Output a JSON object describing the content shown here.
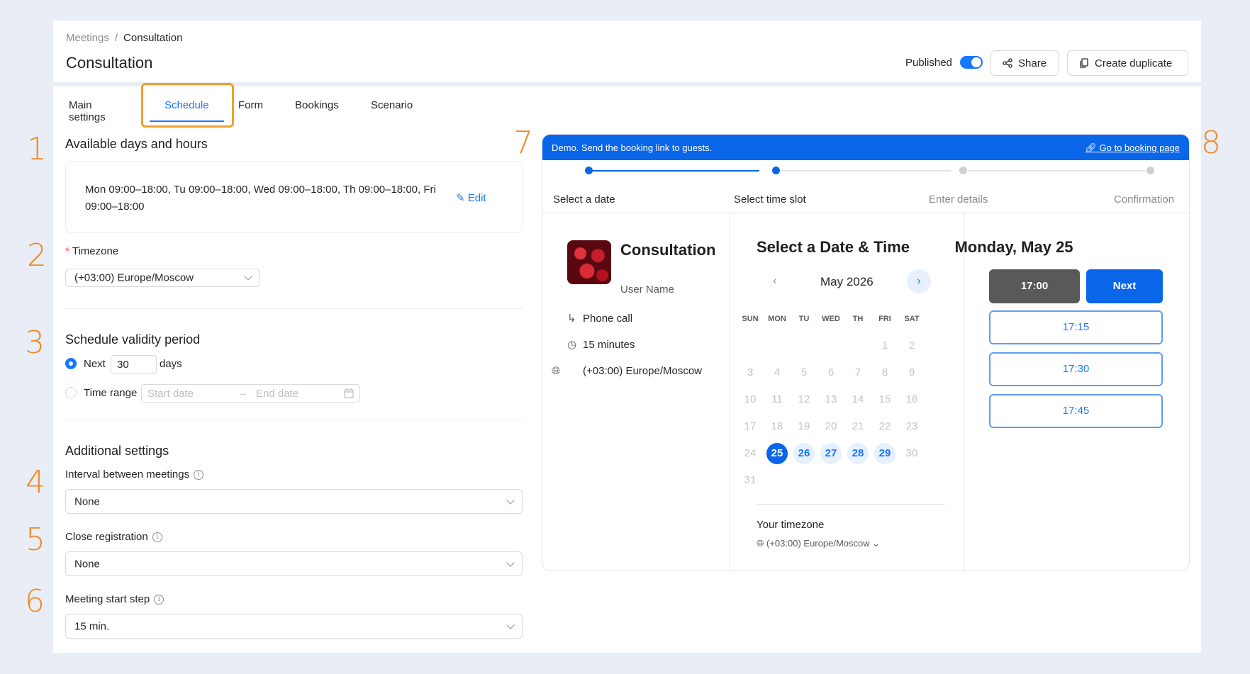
{
  "header": {
    "breadcrumb": [
      "Meetings",
      "Consultation"
    ],
    "breadcrumb_sep": "/",
    "title": "Consultation",
    "published_label": "Published",
    "share_label": "Share",
    "duplicate_label": "Create duplicate"
  },
  "tabs": [
    {
      "label": "Main settings",
      "active": false
    },
    {
      "label": "Schedule",
      "active": true
    },
    {
      "label": "Form",
      "active": false
    },
    {
      "label": "Bookings",
      "active": false
    },
    {
      "label": "Scenario",
      "active": false
    }
  ],
  "annotations": [
    "1",
    "2",
    "3",
    "4",
    "5",
    "6",
    "7",
    "8"
  ],
  "schedule": {
    "available_title": "Available days and hours",
    "hours_text": "Mon 09:00–18:00, Tu 09:00–18:00, Wed 09:00–18:00, Th 09:00–18:00, Fri 09:00–18:00",
    "edit_label": "Edit",
    "timezone_label": "Timezone",
    "timezone_value": "(+03:00) Europe/Moscow",
    "validity_title": "Schedule validity period",
    "next_label": "Next",
    "next_value": "30",
    "days_label": "days",
    "time_range_label": "Time range",
    "start_placeholder": "Start date",
    "end_placeholder": "End date",
    "additional_title": "Additional settings",
    "interval_label": "Interval between meetings",
    "interval_value": "None",
    "close_label": "Close registration",
    "close_value": "None",
    "step_label": "Meeting start step",
    "step_value": "15 min."
  },
  "demo": {
    "bar_text": "Demo. Send the booking link to guests.",
    "bar_link": "Go to booking page",
    "steps": [
      "Select a date",
      "Select time slot",
      "Enter details",
      "Confirmation"
    ],
    "event_title": "Consultation",
    "event_user": "User Name",
    "call_type": "Phone call",
    "duration": "15 minutes",
    "event_tz": "(+03:00) Europe/Moscow",
    "calendar_title": "Select a Date & Time",
    "month": "May 2026",
    "weekdays": [
      "SUN",
      "MON",
      "TU",
      "WED",
      "TH",
      "FRI",
      "SAT"
    ],
    "weeks": [
      [
        "",
        "",
        "",
        "",
        "",
        "1",
        "2"
      ],
      [
        "3",
        "4",
        "5",
        "6",
        "7",
        "8",
        "9"
      ],
      [
        "10",
        "11",
        "12",
        "13",
        "14",
        "15",
        "16"
      ],
      [
        "17",
        "18",
        "19",
        "20",
        "21",
        "22",
        "23"
      ],
      [
        "24",
        "25",
        "26",
        "27",
        "28",
        "29",
        "30"
      ],
      [
        "31",
        "",
        "",
        "",
        "",
        "",
        ""
      ]
    ],
    "selected_day": "25",
    "available_days": [
      "26",
      "27",
      "28",
      "29"
    ],
    "your_tz_label": "Your timezone",
    "your_tz_value": "(+03:00) Europe/Moscow",
    "day_title": "Monday, May 25",
    "selected_slot": "17:00",
    "next_label": "Next",
    "slots": [
      "17:15",
      "17:30",
      "17:45"
    ]
  },
  "colors": {
    "accent": "#1677ff",
    "demo_bar": "#0a66e8",
    "annotation": "#ef8a23",
    "tab_highlight": "#f0a030"
  }
}
